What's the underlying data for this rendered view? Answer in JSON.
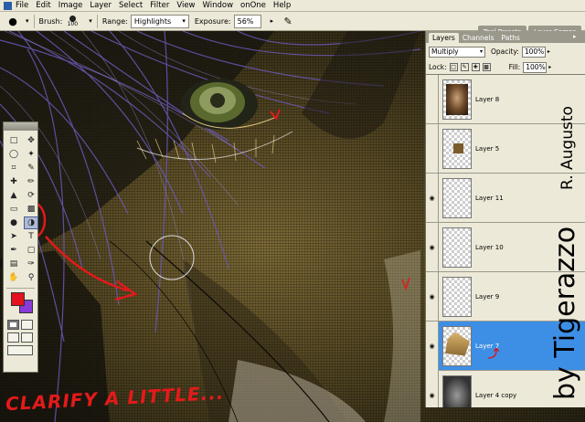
{
  "menu": {
    "items": [
      "File",
      "Edit",
      "Image",
      "Layer",
      "Select",
      "Filter",
      "View",
      "Window",
      "onOne",
      "Help"
    ]
  },
  "options_bar": {
    "brush_label": "Brush:",
    "brush_size": "100",
    "range_label": "Range:",
    "range_value": "Highlights",
    "exposure_label": "Exposure:",
    "exposure_value": "56%",
    "palette_tabs": [
      "Tool Presets",
      "Layer Comps"
    ]
  },
  "tools": {
    "fg_color": "#e3121e",
    "bg_color": "#8a3ad8"
  },
  "layers_panel": {
    "tabs": [
      "Layers",
      "Channels",
      "Paths"
    ],
    "blend_mode": "Multiply",
    "opacity_label": "Opacity:",
    "opacity_value": "100%",
    "lock_label": "Lock:",
    "fill_label": "Fill:",
    "fill_value": "100%",
    "layers": [
      {
        "name": "Layer 8",
        "visible": false,
        "thumb": "face"
      },
      {
        "name": "Layer 5",
        "visible": false,
        "thumb": "patch"
      },
      {
        "name": "Layer 11",
        "visible": true,
        "thumb": "empty"
      },
      {
        "name": "Layer 10",
        "visible": true,
        "thumb": "empty"
      },
      {
        "name": "Layer 9",
        "visible": true,
        "thumb": "empty"
      },
      {
        "name": "Layer 7",
        "visible": true,
        "thumb": "burlap",
        "selected": true
      },
      {
        "name": "Layer 4 copy",
        "visible": true,
        "thumb": "gray"
      }
    ]
  },
  "overlay": {
    "credit_main": "by Tigerazzo",
    "credit_sub": "R. Augusto",
    "caption": "CLARIFY A LITTLE..."
  }
}
